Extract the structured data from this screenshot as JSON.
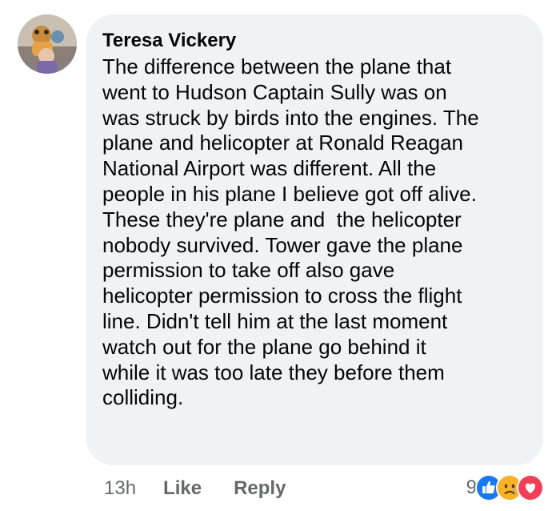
{
  "comment": {
    "author": "Teresa Vickery",
    "lines": [
      "The difference between the plane that",
      "went to Hudson Captain Sully was on",
      "was struck by birds into the engines. The",
      "plane and helicopter at Ronald Reagan",
      "National Airport was different. All the",
      "people in his plane I believe got off alive.",
      "These they're plane and  the helicopter",
      "nobody survived. Tower gave the plane",
      "permission to take off also gave",
      "helicopter permission to cross the flight",
      "line. Didn't tell him at the last moment",
      "watch out for the plane go behind it",
      "while it was too late they before them",
      "colliding."
    ]
  },
  "actions": {
    "timestamp": "13h",
    "like_label": "Like",
    "reply_label": "Reply"
  },
  "reactions": {
    "count": "9",
    "icons": [
      "like-icon",
      "sad-icon",
      "love-icon"
    ],
    "colors": {
      "like": "#1877f2",
      "sad": "#f7b125",
      "love": "#f33e58"
    }
  }
}
